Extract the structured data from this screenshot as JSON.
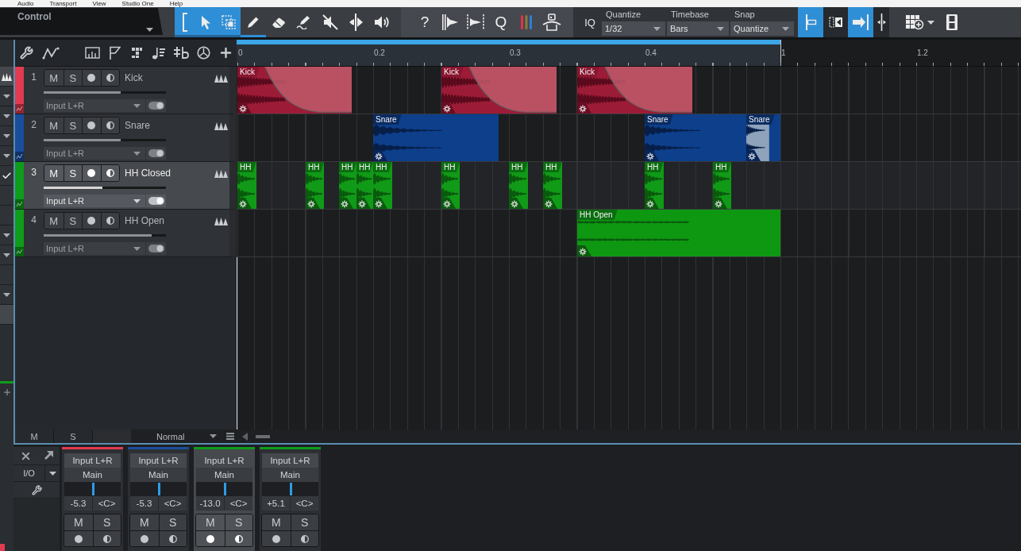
{
  "menu": [
    "Audio",
    "Transport",
    "View",
    "Studio One",
    "Help"
  ],
  "toolbar": {
    "control": {
      "label": "Control"
    },
    "tools": [
      {
        "kind": "bracket",
        "selected": true,
        "underlined": false
      },
      {
        "kind": "arrow",
        "selected": true,
        "underlined": false
      },
      {
        "kind": "range",
        "selected": true,
        "underlined": false
      },
      {
        "kind": "pencil",
        "selected": false,
        "underlined": true
      },
      {
        "kind": "eraser",
        "selected": false,
        "underlined": false
      },
      {
        "kind": "paint",
        "selected": false,
        "underlined": false
      },
      {
        "kind": "mute",
        "selected": false,
        "underlined": false
      },
      {
        "kind": "split",
        "selected": false,
        "underlined": false
      },
      {
        "kind": "listen",
        "selected": false,
        "underlined": false
      }
    ],
    "actions": [
      {
        "kind": "glyph",
        "label": "?"
      },
      {
        "kind": "audio-bend"
      },
      {
        "kind": "audio-stretch"
      },
      {
        "kind": "glyph",
        "label": "Q"
      },
      {
        "kind": "color-bars"
      },
      {
        "kind": "tempo"
      }
    ],
    "iq": "IQ",
    "selectors": [
      {
        "label": "Quantize",
        "value": "1/32"
      },
      {
        "label": "Timebase",
        "value": "Bars"
      },
      {
        "label": "Snap",
        "value": "Quantize"
      }
    ],
    "snap_buttons": [
      {
        "kind": "snap-grid",
        "selected": true
      },
      {
        "kind": "snap-events",
        "selected": false
      },
      {
        "kind": "snap-end",
        "selected": true
      },
      {
        "kind": "split-marker",
        "selected": false
      }
    ],
    "view_buttons": [
      {
        "kind": "grid-add"
      },
      {
        "kind": "video"
      }
    ]
  },
  "inspector": {
    "rows": [
      {
        "kind": "waveform",
        "checked": false
      },
      {
        "kind": "dropdown",
        "checked": false
      },
      {
        "kind": "dropdown",
        "checked": false
      },
      {
        "kind": "dropdown",
        "checked": false
      },
      {
        "kind": "dropdown",
        "checked": false
      },
      {
        "kind": "blank",
        "checked": true
      },
      {
        "kind": "blank",
        "checked": false
      },
      {
        "kind": "blank",
        "checked": false
      },
      {
        "kind": "dropdown",
        "checked": false
      },
      {
        "kind": "dropdown",
        "checked": false
      },
      {
        "kind": "blank",
        "checked": false
      },
      {
        "kind": "dropdown",
        "checked": false
      },
      {
        "kind": "slot",
        "checked": false
      }
    ]
  },
  "track_toolbar": {
    "buttons": [
      {
        "kind": "wrench"
      },
      {
        "kind": "automation"
      },
      {
        "kind": "mixer"
      },
      {
        "kind": "marker"
      },
      {
        "kind": "chord"
      },
      {
        "kind": "notes"
      },
      {
        "kind": "fx"
      },
      {
        "kind": "clock"
      },
      {
        "kind": "add"
      }
    ]
  },
  "ruler": {
    "labels": [
      "0",
      "0.2",
      "0.3",
      "0.4",
      "1",
      "1.2"
    ]
  },
  "tracks": [
    {
      "number": "1",
      "name": "Kick",
      "color": "#e23a50",
      "selected": false,
      "mute": "M",
      "solo": "S",
      "volume": {
        "level": 0.63
      },
      "input": "Input L+R",
      "clips": [
        {
          "label": "Kick",
          "kind": "fade",
          "selected": false
        },
        {
          "label": "Kick",
          "kind": "fade",
          "selected": false
        },
        {
          "label": "Kick",
          "kind": "fade",
          "selected": false
        }
      ]
    },
    {
      "number": "2",
      "name": "Snare",
      "color": "#1a4d9c",
      "selected": false,
      "mute": "M",
      "solo": "S",
      "volume": {
        "level": 0.63
      },
      "input": "Input L+R",
      "clips": [
        {
          "label": "Snare",
          "kind": "burst",
          "selected": false
        },
        {
          "label": "Snare",
          "kind": "burst",
          "selected": false
        },
        {
          "label": "Snare",
          "kind": "burst",
          "selected": true
        }
      ]
    },
    {
      "number": "3",
      "name": "HH Closed",
      "color": "#0e9c1a",
      "selected": true,
      "mute": "M",
      "solo": "S",
      "volume": {
        "level": 0.48
      },
      "input": "Input L+R",
      "clips": [
        {
          "label": "HH",
          "kind": "hit",
          "selected": false
        },
        {
          "label": "HH",
          "kind": "hit",
          "selected": false
        },
        {
          "label": "HH",
          "kind": "hit",
          "selected": false
        },
        {
          "label": "HH",
          "kind": "hit",
          "selected": false
        },
        {
          "label": "HH",
          "kind": "hit",
          "selected": false
        },
        {
          "label": "HH",
          "kind": "hit",
          "selected": false
        },
        {
          "label": "HH",
          "kind": "hit",
          "selected": false
        },
        {
          "label": "HH",
          "kind": "hit",
          "selected": false
        },
        {
          "label": "HH",
          "kind": "hit",
          "selected": false
        },
        {
          "label": "HH",
          "kind": "hit",
          "selected": false
        }
      ]
    },
    {
      "number": "4",
      "name": "HH Open",
      "color": "#0e9c1a",
      "selected": false,
      "mute": "M",
      "solo": "S",
      "volume": {
        "level": 0.88
      },
      "input": "Input L+R",
      "clips": [
        {
          "label": "HH Open",
          "kind": "long",
          "selected": false
        }
      ]
    }
  ],
  "arrange_footer": {
    "mute": "M",
    "solo": "S",
    "mode": "Normal"
  },
  "mixer": {
    "io": "I/O",
    "channels": [
      {
        "input": "Input L+R",
        "output": "Main",
        "pan": {
          "level": 0.5
        },
        "volume": "-5.3",
        "pan_reading": "<C>",
        "mute": "M",
        "solo": "S",
        "color": "#e23a50",
        "selected": false
      },
      {
        "input": "Input L+R",
        "output": "Main",
        "pan": {
          "level": 0.5
        },
        "volume": "-5.3",
        "pan_reading": "<C>",
        "mute": "M",
        "solo": "S",
        "color": "#1a4d9c",
        "selected": false
      },
      {
        "input": "Input L+R",
        "output": "Main",
        "pan": {
          "level": 0.5
        },
        "volume": "-13.0",
        "pan_reading": "<C>",
        "mute": "M",
        "solo": "S",
        "color": "#0e9c1a",
        "selected": true
      },
      {
        "input": "Input L+R",
        "output": "Main",
        "pan": {
          "level": 0.5
        },
        "volume": "+5.1",
        "pan_reading": "<C>",
        "mute": "M",
        "solo": "S",
        "color": "#0e9c1a",
        "selected": false
      }
    ]
  }
}
